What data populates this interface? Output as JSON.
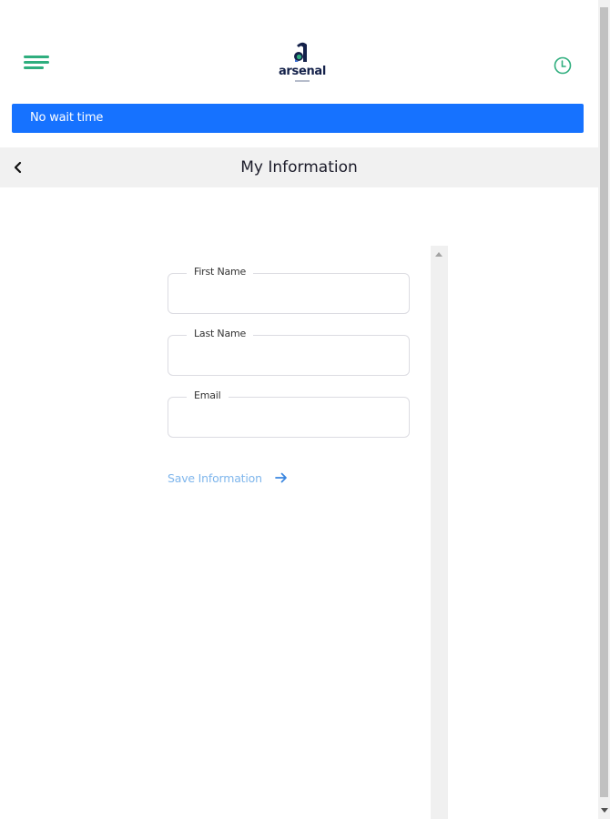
{
  "header": {
    "menu_icon": "hamburger-menu-icon",
    "logo_text": "arsenal",
    "clock_icon": "clock-icon",
    "accent_color": "#2fae7e",
    "logo_color": "#14214a"
  },
  "banner": {
    "text": "No wait time",
    "color": "#1672ff"
  },
  "titlebar": {
    "back_icon": "chevron-left-icon",
    "title": "My Information"
  },
  "form": {
    "first_name": {
      "label": "First Name",
      "value": ""
    },
    "last_name": {
      "label": "Last Name",
      "value": ""
    },
    "email": {
      "label": "Email",
      "value": ""
    },
    "save_label": "Save Information",
    "save_icon": "arrow-right-icon",
    "link_color": "#7fb6ec"
  }
}
